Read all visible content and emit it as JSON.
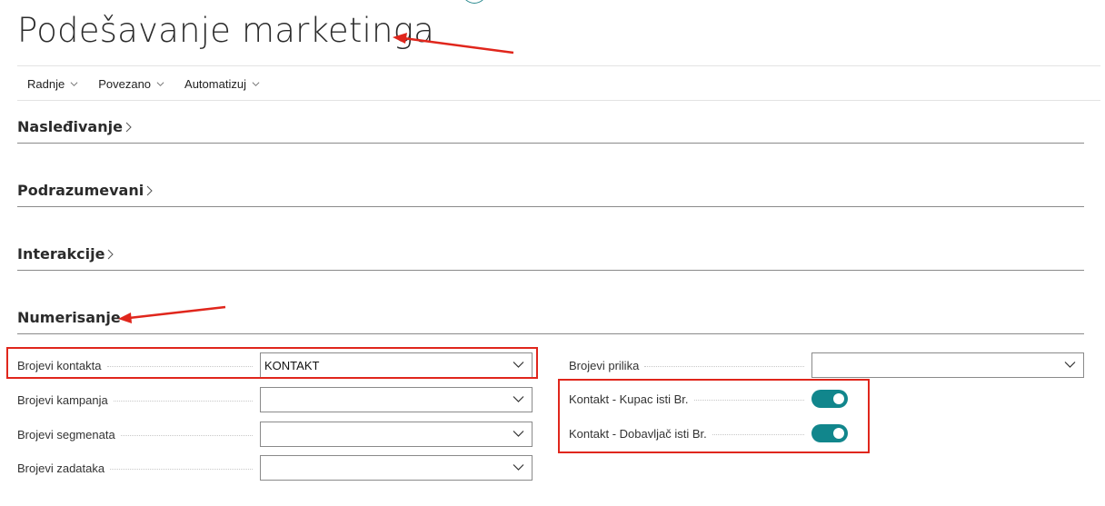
{
  "page": {
    "title": "Podešavanje marketinga"
  },
  "actions": [
    {
      "label": "Radnje"
    },
    {
      "label": "Povezano"
    },
    {
      "label": "Automatizuj"
    }
  ],
  "sections": {
    "inheritance": "Nasleđivanje",
    "defaults": "Podrazumevani",
    "interactions": "Interakcije",
    "numbering": "Numerisanje"
  },
  "numbering": {
    "left_fields": [
      {
        "label": "Brojevi kontakta",
        "value": "KONTAKT"
      },
      {
        "label": "Brojevi kampanja",
        "value": ""
      },
      {
        "label": "Brojevi segmenata",
        "value": ""
      },
      {
        "label": "Brojevi zadataka",
        "value": ""
      }
    ],
    "right_fields": [
      {
        "label": "Brojevi prilika",
        "value": ""
      }
    ],
    "toggles": [
      {
        "label": "Kontakt - Kupac isti Br.",
        "on": true
      },
      {
        "label": "Kontakt - Dobavljač isti Br.",
        "on": true
      }
    ]
  },
  "colors": {
    "accent": "#11868c",
    "annotation": "#e0261c"
  }
}
